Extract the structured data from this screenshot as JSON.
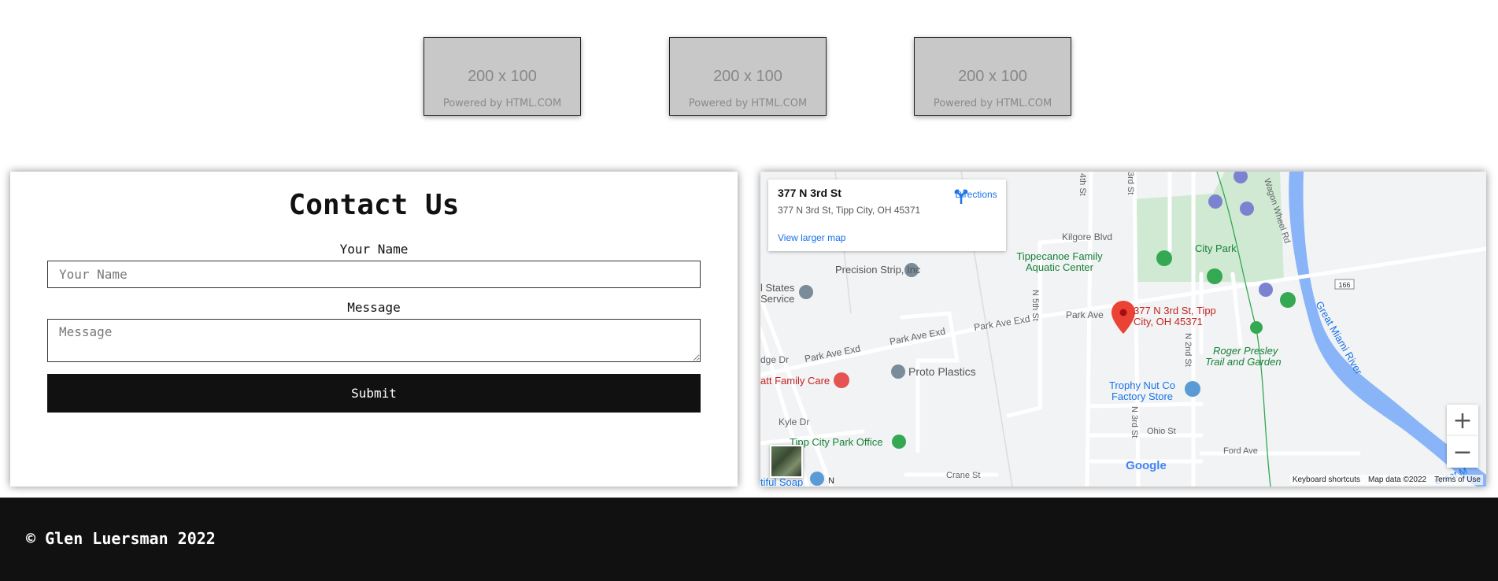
{
  "placeholders": [
    {
      "size": "200 x 100",
      "powered": "Powered by HTML.COM"
    },
    {
      "size": "200 x 100",
      "powered": "Powered by HTML.COM"
    },
    {
      "size": "200 x 100",
      "powered": "Powered by HTML.COM"
    }
  ],
  "contact": {
    "title": "Contact Us",
    "name_label": "Your Name",
    "name_placeholder": "Your Name",
    "message_label": "Message",
    "message_placeholder": "Message",
    "submit_label": "Submit"
  },
  "map": {
    "card_title": "377 N 3rd St",
    "card_address": "377 N 3rd St, Tipp City, OH 45371",
    "directions_label": "Directions",
    "larger_map_label": "View larger map",
    "marker_label_line1": "377 N 3rd St, Tipp",
    "marker_label_line2": "City, OH 45371",
    "places": {
      "kilgore": "Kilgore Blvd",
      "precision": "Precision Strip, Inc",
      "tippecanoe1": "Tippecanoe Family",
      "tippecanoe2": "Aquatic Center",
      "city_park": "City Park",
      "states": "l States",
      "service": "Service",
      "park_ave_exd1": "Park Ave Exd",
      "park_ave_exd2": "Park Ave Exd",
      "park_ave_exd3": "Park Ave Exd",
      "park_ave": "Park Ave",
      "n5th": "N 5th St",
      "fourth": "4th St",
      "third_top": "3rd St",
      "n2nd": "N 2nd St",
      "n3rd": "N 3rd St",
      "wagon": "Wagon Wheel Rd",
      "roger1": "Roger Presley",
      "roger2": "Trail and Garden",
      "river": "Great Miami River",
      "ridge": "dge Dr",
      "proto": "Proto Plastics",
      "family_care": "att Family Care",
      "trophy1": "Trophy Nut Co",
      "trophy2": "Factory Store",
      "kyle": "Kyle Dr",
      "ohio": "Ohio St",
      "ford": "Ford Ave",
      "tipp_office": "Tipp City Park Office",
      "crane": "Crane St",
      "soap": "tiful Soap",
      "n_bottom": "N",
      "route": "166",
      "river_bottom": "Great M",
      "google": "Google"
    },
    "zoom_in": "+",
    "zoom_out": "−",
    "attribution": {
      "shortcuts": "Keyboard shortcuts",
      "data": "Map data ©2022",
      "terms": "Terms of Use"
    }
  },
  "footer": {
    "copyright": "© Glen Luersman 2022"
  }
}
